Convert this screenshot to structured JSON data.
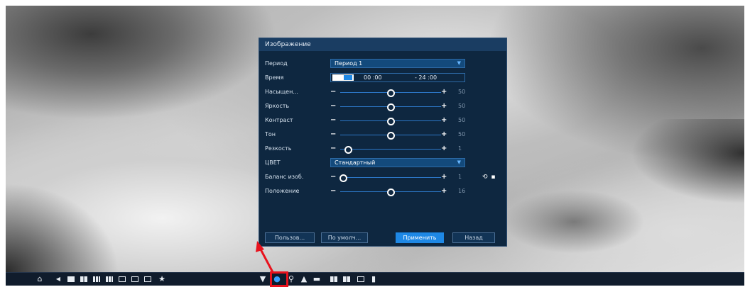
{
  "dialog": {
    "title": "Изображение",
    "period": {
      "label": "Период",
      "value": "Период 1"
    },
    "time": {
      "label": "Время",
      "start": "00 :00",
      "end": "- 24 :00",
      "enabled": true
    },
    "sliders": [
      {
        "key": "saturation",
        "label": "Насыщен...",
        "value": "50",
        "level": 0.5
      },
      {
        "key": "brightness",
        "label": "Яркость",
        "value": "50",
        "level": 0.5
      },
      {
        "key": "contrast",
        "label": "Контраст",
        "value": "50",
        "level": 0.5
      },
      {
        "key": "hue",
        "label": "Тон",
        "value": "50",
        "level": 0.5
      }
    ],
    "sharpness": {
      "label": "Резкость",
      "value": "1",
      "level": 0.08
    },
    "color": {
      "label": "ЦВЕТ",
      "value": "Стандартный"
    },
    "balance": {
      "label": "Баланс изоб.",
      "value": "1",
      "level": 0.03
    },
    "position": {
      "label": "Положение",
      "value": "16",
      "level": 0.5
    },
    "buttons": {
      "custom": "Пользов...",
      "default": "По умолч...",
      "apply": "Применить",
      "back": "Назад"
    }
  },
  "colors": {
    "accent": "#1e88e5",
    "dialog_bg": "#0e2740",
    "highlight": "#e8121d"
  },
  "taskbar": {
    "icons": [
      "home-icon",
      "back-arrow-icon",
      "single-view-icon",
      "quad-view-icon",
      "view-8-icon",
      "view-9-icon",
      "view-16-icon",
      "view-custom-icon",
      "sequence-icon",
      "favorite-star-icon",
      "ptz-icon",
      "color-settings-icon",
      "search-icon",
      "alarm-warning-icon",
      "network-icon",
      "hdd-icon",
      "info-icon",
      "backup-icon",
      "usb-icon"
    ]
  }
}
